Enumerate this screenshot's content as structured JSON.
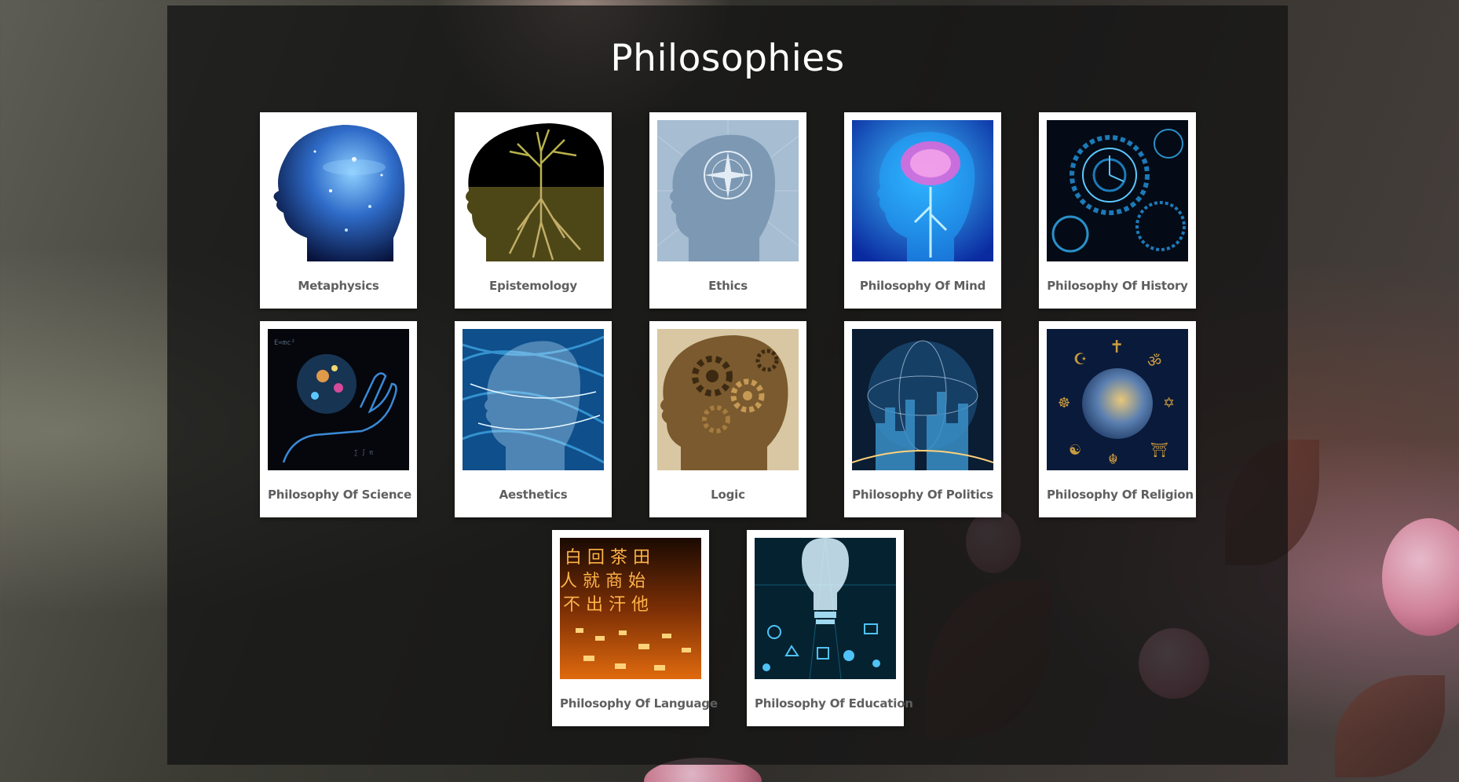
{
  "page": {
    "title": "Philosophies"
  },
  "cards": [
    {
      "label": "Metaphysics",
      "icon": "cosmic-head-silhouette-icon",
      "colors": [
        "#ffffff",
        "#0b1a48",
        "#3c7fd9"
      ]
    },
    {
      "label": "Epistemology",
      "icon": "tree-roots-head-icon",
      "colors": [
        "#000000",
        "#4d4718",
        "#b9b24c"
      ]
    },
    {
      "label": "Ethics",
      "icon": "compass-head-icon",
      "colors": [
        "#a6bdd2",
        "#7c98b3",
        "#c9d6e3"
      ]
    },
    {
      "label": "Philosophy Of Mind",
      "icon": "glowing-brain-head-icon",
      "colors": [
        "#0a2aa0",
        "#21a8ff",
        "#ff5fd6"
      ]
    },
    {
      "label": "Philosophy Of History",
      "icon": "clockwork-gears-icon",
      "colors": [
        "#040b16",
        "#1d7ab8",
        "#5cc8ff"
      ]
    },
    {
      "label": "Philosophy Of Science",
      "icon": "hand-with-molecules-icon",
      "colors": [
        "#05070d",
        "#3a8ad6",
        "#e09a4a"
      ]
    },
    {
      "label": "Aesthetics",
      "icon": "light-waves-head-icon",
      "colors": [
        "#0e4f8c",
        "#3fa3e0",
        "#c8ecff"
      ]
    },
    {
      "label": "Logic",
      "icon": "gears-head-icon",
      "colors": [
        "#d8c7a2",
        "#7a5a2e",
        "#3c2912"
      ]
    },
    {
      "label": "Philosophy Of Politics",
      "icon": "globe-city-icon",
      "colors": [
        "#0a1d33",
        "#3a8fc7",
        "#cfe7ff"
      ]
    },
    {
      "label": "Philosophy Of Religion",
      "icon": "earth-religious-symbols-icon",
      "colors": [
        "#0a1a3a",
        "#c99a3f",
        "#5a7fb0"
      ]
    },
    {
      "label": "Philosophy Of Language",
      "icon": "glowing-characters-icon",
      "colors": [
        "#1a0a02",
        "#e06a0e",
        "#ffb347"
      ]
    },
    {
      "label": "Philosophy Of Education",
      "icon": "lightbulb-icons-icon",
      "colors": [
        "#052230",
        "#1f8fb5",
        "#d9f3ff"
      ]
    }
  ]
}
